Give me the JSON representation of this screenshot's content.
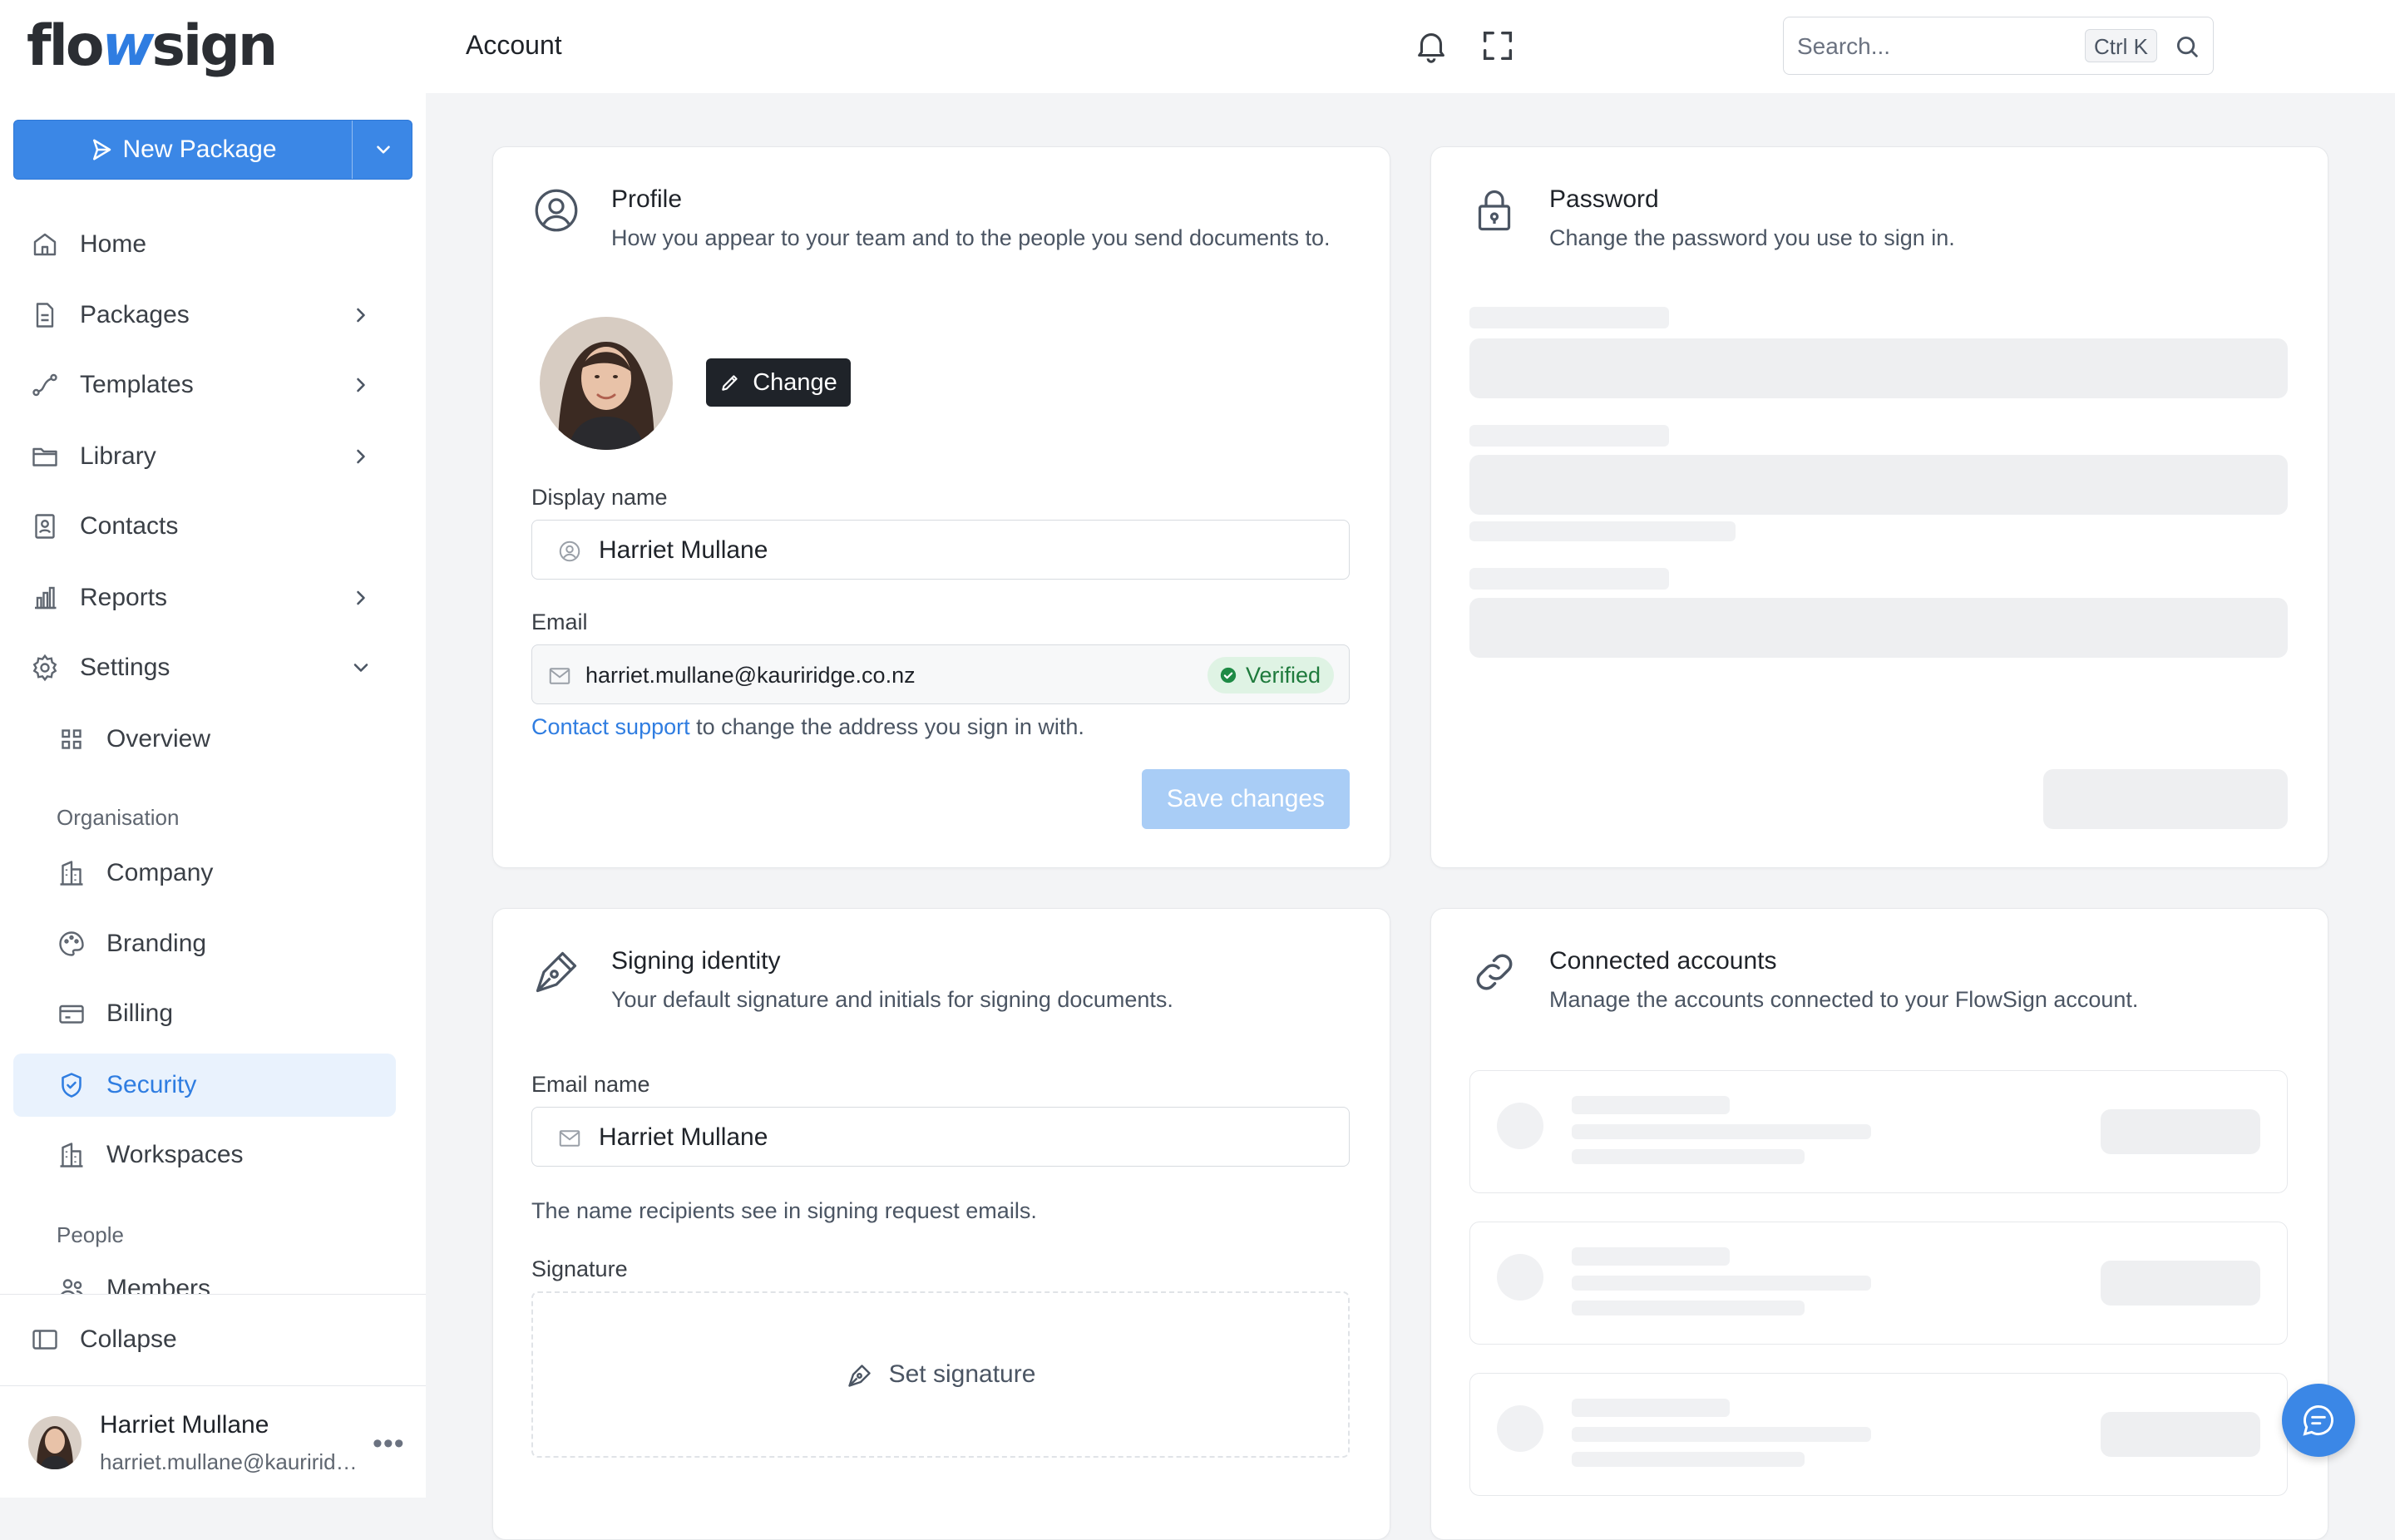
{
  "brand": {
    "logo_left": "flo",
    "logo_mid": "w",
    "logo_right": "sign"
  },
  "sidebar": {
    "new_package_label": "New Package",
    "items": [
      {
        "label": "Home"
      },
      {
        "label": "Packages"
      },
      {
        "label": "Templates"
      },
      {
        "label": "Library"
      },
      {
        "label": "Contacts"
      },
      {
        "label": "Reports"
      },
      {
        "label": "Settings"
      }
    ],
    "settings_sub": {
      "overview": "Overview",
      "org_section": "Organisation",
      "company": "Company",
      "branding": "Branding",
      "billing": "Billing",
      "security": "Security",
      "workspaces": "Workspaces",
      "people_section": "People",
      "members": "Members"
    },
    "collapse_label": "Collapse",
    "user": {
      "name": "Harriet Mullane",
      "email": "harriet.mullane@kauriridge.co.nz"
    }
  },
  "header": {
    "title": "Account",
    "search_placeholder": "Search...",
    "search_shortcut": "Ctrl K"
  },
  "profile": {
    "title": "Profile",
    "subtitle": "How you appear to your team and to the people you send documents to.",
    "change_label": "Change",
    "display_name_label": "Display name",
    "display_name_value": "Harriet Mullane",
    "email_label": "Email",
    "email_value": "harriet.mullane@kauriridge.co.nz",
    "verified_label": "Verified",
    "contact_support": "Contact support",
    "contact_rest": " to change the address you sign in with.",
    "save_label": "Save changes"
  },
  "password": {
    "title": "Password",
    "subtitle": "Change the password you use to sign in."
  },
  "signing": {
    "title": "Signing identity",
    "subtitle": "Your default signature and initials for signing documents.",
    "email_name_label": "Email name",
    "email_name_value": "Harriet Mullane",
    "email_name_helper": "The name recipients see in signing request emails.",
    "signature_label": "Signature",
    "set_signature_label": "Set signature"
  },
  "connected": {
    "title": "Connected accounts",
    "subtitle": "Manage the accounts connected to your FlowSign account."
  },
  "colors": {
    "accent": "#3b87e6",
    "active_bg": "#e9f2fd",
    "verified_bg": "#dff3e4",
    "verified_text": "#1e7a3c"
  },
  "icons": [
    "send-icon",
    "chevron-down-icon",
    "home-icon",
    "file-icon",
    "route-icon",
    "folder-icon",
    "contacts-icon",
    "bar-chart-icon",
    "gear-icon",
    "grid-icon",
    "building-icon",
    "palette-icon",
    "credit-card-icon",
    "shield-check-icon",
    "users-icon",
    "sidebar-collapse-icon",
    "more-icon",
    "search-icon",
    "bell-icon",
    "fullscreen-icon",
    "user-circle-icon",
    "lock-icon",
    "pen-nib-icon",
    "link-icon",
    "mail-icon",
    "pencil-icon",
    "chat-icon"
  ]
}
